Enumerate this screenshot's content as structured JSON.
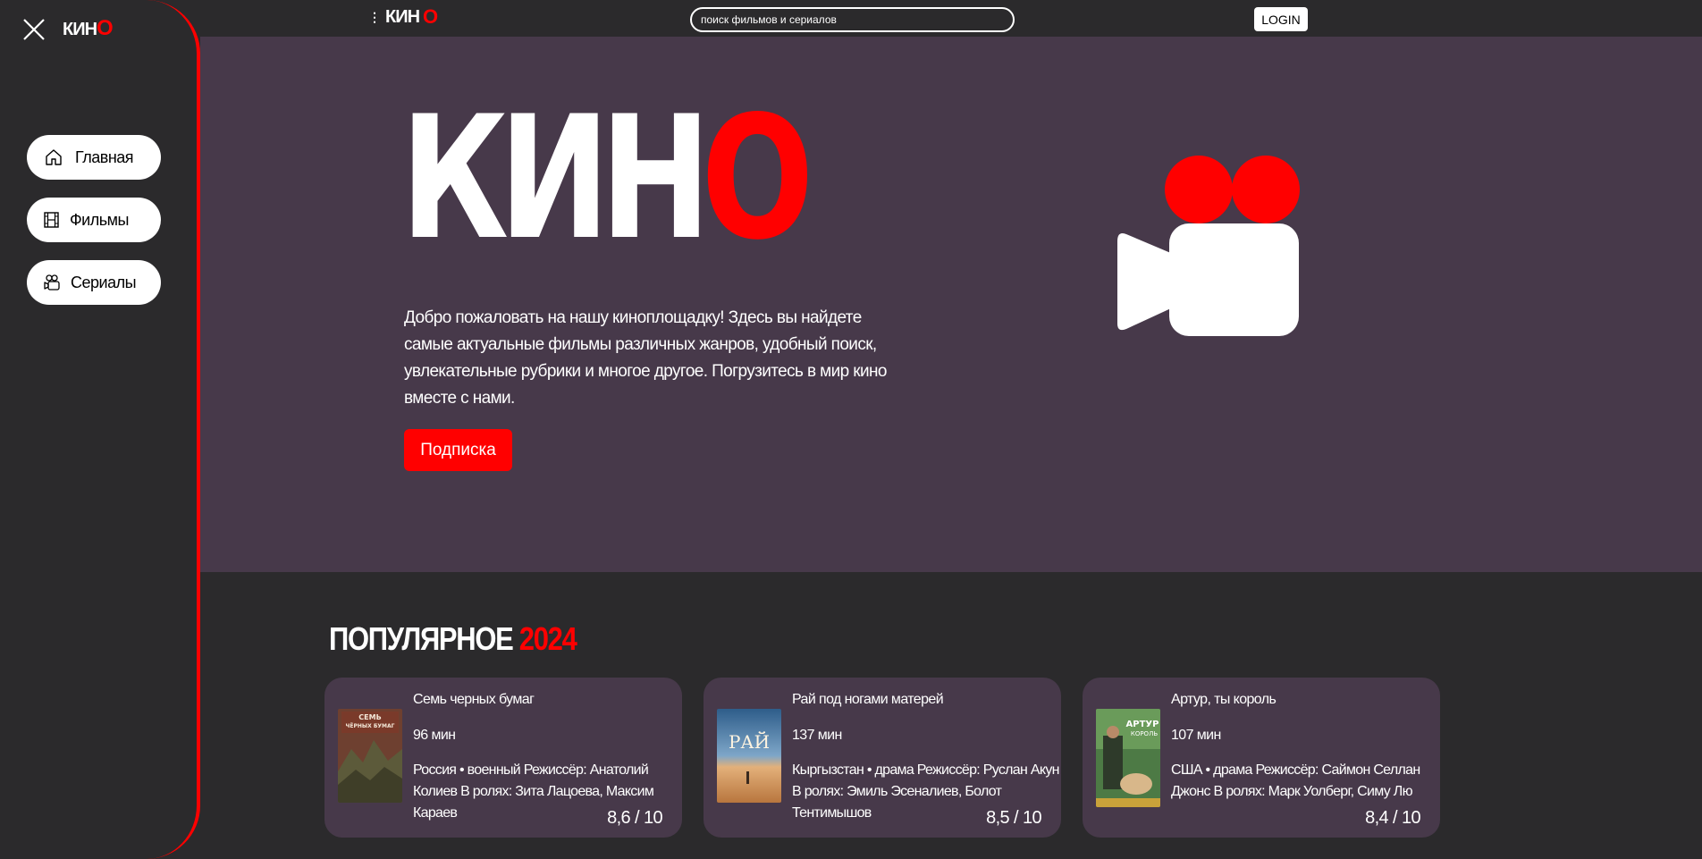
{
  "header": {
    "logo": {
      "text": "КИН",
      "accent": "О"
    },
    "search_placeholder": "поиск фильмов и сериалов",
    "login_label": "LOGIN"
  },
  "sidebar": {
    "logo": {
      "text": "КИН",
      "accent": "О"
    },
    "items": [
      {
        "label": "Главная",
        "icon": "home-icon"
      },
      {
        "label": "Фильмы",
        "icon": "film-icon"
      },
      {
        "label": "Сериалы",
        "icon": "camera-icon"
      }
    ]
  },
  "hero": {
    "logo": {
      "text": "КИН",
      "accent": "О"
    },
    "description": "Добро пожаловать на нашу киноплощадку! Здесь вы найдете самые актуальные фильмы различных жанров, удобный поиск, увлекательные рубрики и многое другое. Погрузитесь в мир кино вместе с нами.",
    "button_label": "Подписка"
  },
  "popular": {
    "title": "ПОПУЛЯРНОЕ",
    "year": "2024",
    "cards": [
      {
        "title": "Семь черных бумаг",
        "duration": "96 мин",
        "info": "Россия • военный  Режиссёр: Анатолий Колиев В ролях: Зита Лацоева, Максим Караев",
        "rating": "8,6 / 10"
      },
      {
        "title": "Рай под ногами матерей",
        "duration": "137 мин",
        "info": "Кыргызстан • драма  Режиссёр: Руслан Акун В ролях: Эмиль Эсеналиев, Болот Тентимышов",
        "rating": "8,5 / 10"
      },
      {
        "title": "Артур, ты король",
        "duration": "107 мин",
        "info": "США • драма  Режиссёр: Саймон Селлан Джонс В ролях: Марк Уолберг, Симу Лю",
        "rating": "8,4 / 10"
      }
    ]
  },
  "colors": {
    "accent": "#ff0000",
    "background": "#2b2a2c",
    "hero_bg": "#47394a"
  }
}
